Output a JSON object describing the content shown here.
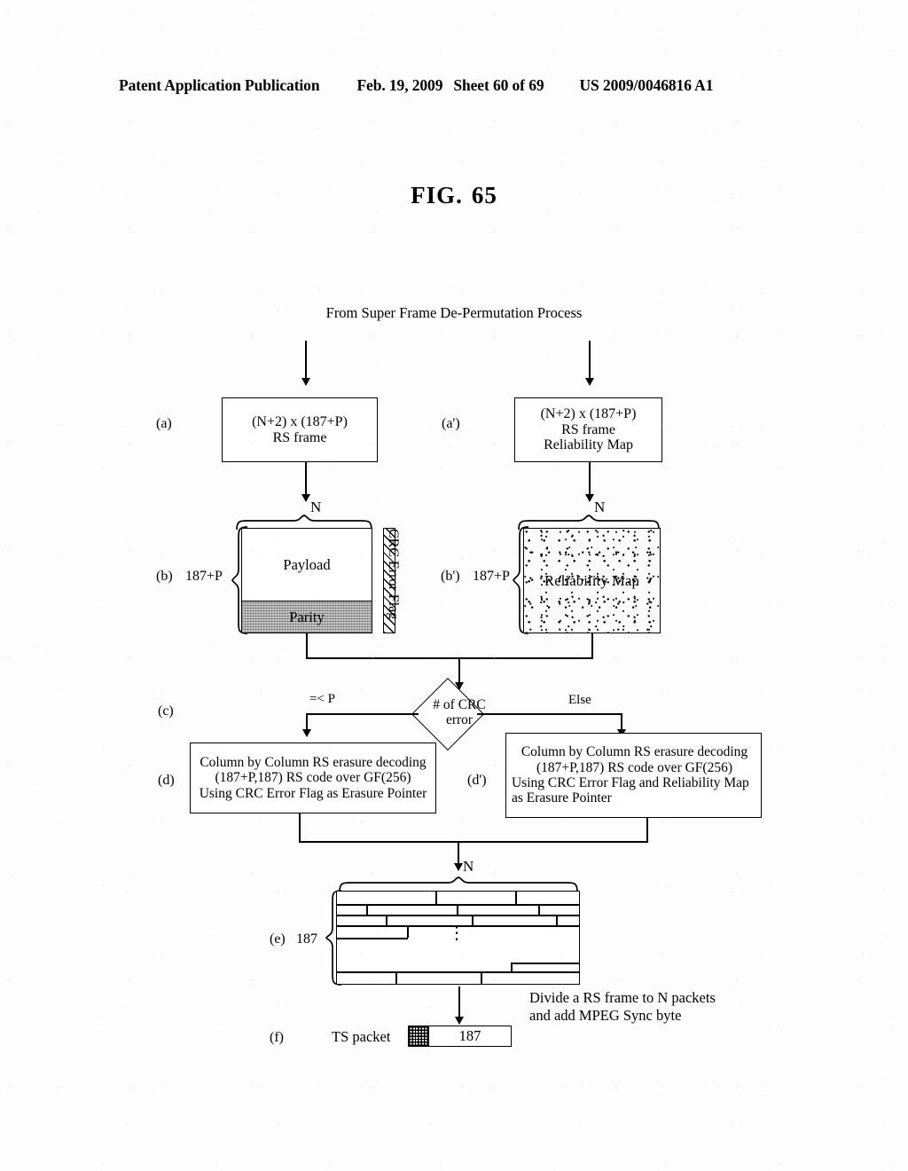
{
  "header": {
    "publication": "Patent Application Publication",
    "date": "Feb. 19, 2009",
    "sheet": "Sheet 60 of 69",
    "patent_number": "US 2009/0046816 A1"
  },
  "figure": {
    "label": "FIG.",
    "number": "65",
    "source_text": "From Super Frame De-Permutation Process"
  },
  "steps": {
    "a": {
      "tag": "(a)",
      "line1": "(N+2) x (187+P)",
      "line2": "RS frame"
    },
    "a_prime": {
      "tag": "(a')",
      "line1": "(N+2) x (187+P)",
      "line2": "RS frame",
      "line3": "Reliability Map"
    },
    "b": {
      "tag": "(b)",
      "row_label": "187+P",
      "col_label": "N",
      "payload": "Payload",
      "parity": "Parity",
      "crc_flag": "CRC Error Flag"
    },
    "b_prime": {
      "tag": "(b')",
      "row_label": "187+P",
      "col_label": "N",
      "reliability_map": "Reliability Map"
    },
    "c": {
      "tag": "(c)",
      "decision_line1": "# of CRC",
      "decision_line2": "error",
      "branch_left": "=< P",
      "branch_right": "Else"
    },
    "d": {
      "tag": "(d)",
      "line1": "Column by Column RS erasure decoding",
      "line2": "(187+P,187) RS code over GF(256)",
      "line3": "Using CRC Error Flag as Erasure Pointer"
    },
    "d_prime": {
      "tag": "(d')",
      "line1": "Column by Column RS erasure decoding",
      "line2": "(187+P,187) RS code over GF(256)",
      "line3": "Using CRC Error Flag and Reliability Map",
      "line4": "as Erasure Pointer"
    },
    "e": {
      "tag": "(e)",
      "row_label": "187",
      "col_label": "N",
      "ellipsis": "⋮"
    },
    "f": {
      "tag": "(f)",
      "packet_label": "TS packet",
      "payload_size": "187",
      "note_line1": "Divide a RS frame to N packets",
      "note_line2": "and add MPEG Sync byte"
    }
  },
  "colors": {
    "ink": "#000000",
    "paper": "#ffffff",
    "parity_fill": "#c9c9c9"
  }
}
